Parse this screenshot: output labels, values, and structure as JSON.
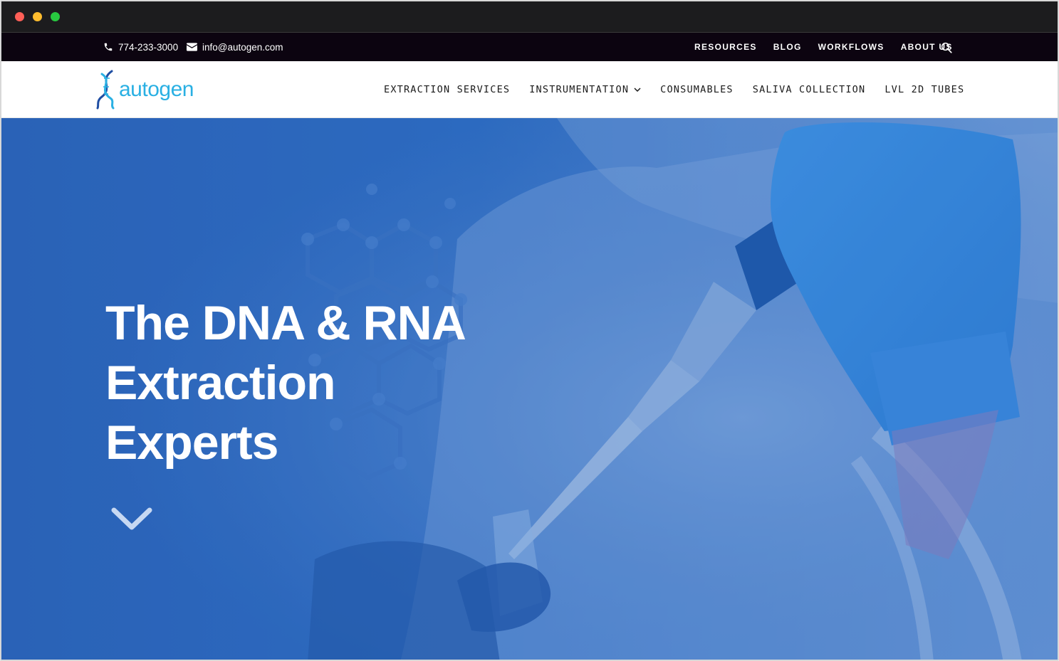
{
  "window": {
    "controls": [
      "close",
      "minimize",
      "maximize"
    ]
  },
  "topbar": {
    "phone": "774-233-3000",
    "phone_icon": "phone-icon",
    "email": "info@autogen.com",
    "email_icon": "envelope-icon",
    "links": [
      "RESOURCES",
      "BLOG",
      "WORKFLOWS",
      "ABOUT US"
    ],
    "search_icon": "search-icon"
  },
  "header": {
    "logo_text": "autogen",
    "logo_icon": "dna-helix-icon",
    "nav": [
      {
        "label": "EXTRACTION SERVICES"
      },
      {
        "label": "INSTRUMENTATION",
        "has_dropdown": true
      },
      {
        "label": "CONSUMABLES"
      },
      {
        "label": "SALIVA COLLECTION"
      },
      {
        "label": "LVL 2D TUBES"
      }
    ]
  },
  "hero": {
    "title_lines": [
      "The DNA & RNA",
      "Extraction",
      "Experts"
    ],
    "scroll_icon": "chevron-down-icon"
  },
  "colors": {
    "topbar_bg": "#0c0410",
    "hero_overlay": "#2a66bc",
    "brand": "#2ab0e3",
    "glove": "#3d8fe0"
  }
}
